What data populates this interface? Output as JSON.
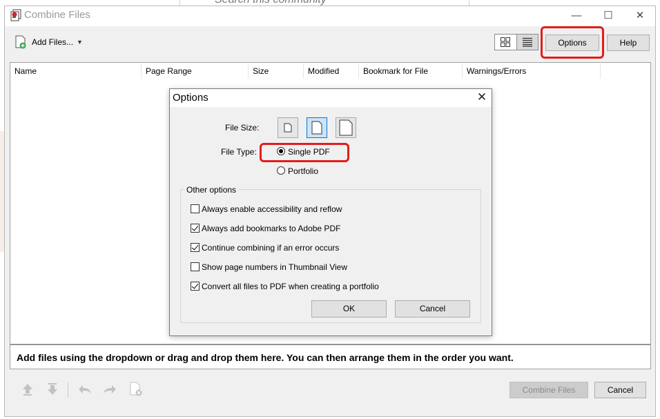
{
  "background": {
    "search_placeholder": "Search this community"
  },
  "window": {
    "title": "Combine Files",
    "controls": [
      "minimize",
      "maximize",
      "close"
    ]
  },
  "toolbar": {
    "add_files_label": "Add Files...",
    "options_label": "Options",
    "help_label": "Help",
    "view_modes": [
      "thumbnail-view-icon",
      "list-view-icon"
    ],
    "selected_view": "list"
  },
  "table": {
    "columns": [
      "Name",
      "Page Range",
      "Size",
      "Modified",
      "Bookmark for File",
      "Warnings/Errors"
    ],
    "rows": []
  },
  "instructions": "Add files using the dropdown or drag and drop them here. You can then arrange them in the order you want.",
  "footer": {
    "icons": [
      "move-up-icon",
      "move-down-icon",
      "undo-icon",
      "redo-icon",
      "remove-file-icon"
    ],
    "combine_label": "Combine Files",
    "cancel_label": "Cancel"
  },
  "dialog": {
    "title": "Options",
    "file_size_label": "File Size:",
    "file_size_options": [
      "small",
      "default",
      "large"
    ],
    "file_size_selected": "default",
    "file_type_label": "File Type:",
    "file_type_options": [
      "Single PDF",
      "Portfolio"
    ],
    "file_type_selected": "Single PDF",
    "other_options_label": "Other options",
    "checkboxes": [
      {
        "label": "Always enable accessibility and reflow",
        "checked": false
      },
      {
        "label": "Always add bookmarks to Adobe PDF",
        "checked": true
      },
      {
        "label": "Continue combining if an error occurs",
        "checked": true
      },
      {
        "label": "Show page numbers in Thumbnail View",
        "checked": false
      },
      {
        "label": "Convert all files to PDF when creating a portfolio",
        "checked": true
      }
    ],
    "ok_label": "OK",
    "cancel_label": "Cancel"
  },
  "highlight_color": "#e41b1b"
}
